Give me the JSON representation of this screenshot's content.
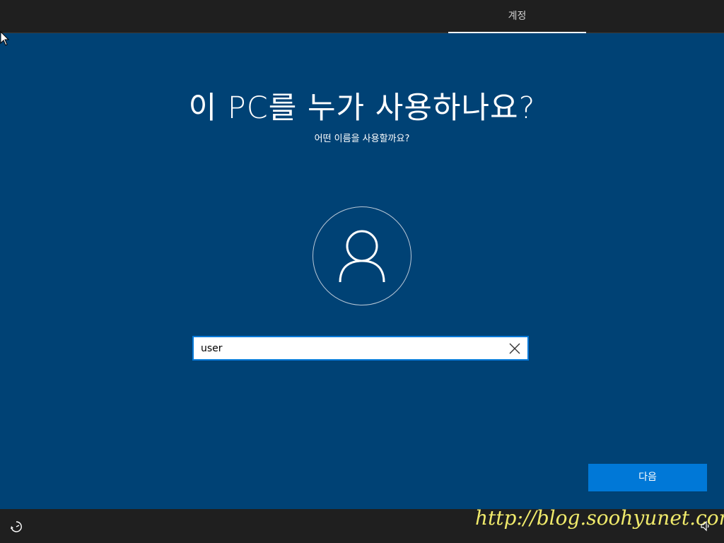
{
  "header": {
    "tab_label": "계정"
  },
  "main": {
    "title": "이 PC를 누가 사용하나요?",
    "subtitle": "어떤 이름을 사용할까요?",
    "name_input": {
      "value": "user",
      "placeholder": ""
    },
    "next_label": "다음"
  },
  "footer": {
    "watermark": "http://blog.soohyunet.com",
    "icons": [
      "ease-of-access-icon",
      "volume-icon"
    ]
  },
  "colors": {
    "background": "#004275",
    "bar": "#1f1f1f",
    "accent": "#0078d7",
    "watermark": "#f0ea6b"
  }
}
